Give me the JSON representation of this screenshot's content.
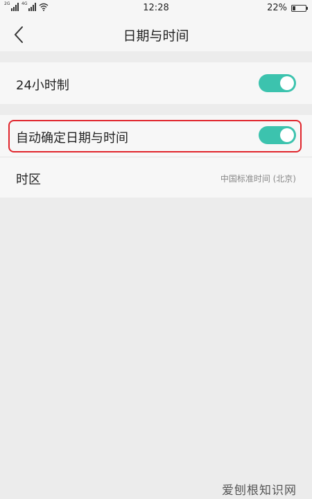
{
  "status_bar": {
    "left_sim1": "2G",
    "left_sim2": "4G",
    "time": "12:28",
    "battery_text": "22%",
    "battery_level": 0.22
  },
  "header": {
    "title": "日期与时间",
    "back_icon": "chevron-left-icon"
  },
  "settings": {
    "hour24": {
      "label": "24小时制",
      "enabled": true
    },
    "auto_datetime": {
      "label": "自动确定日期与时间",
      "enabled": true
    },
    "timezone": {
      "label": "时区",
      "value": "中国标准时间 (北京)"
    }
  },
  "colors": {
    "toggle_on": "#3cc3ae",
    "highlight_border": "#e0242b"
  },
  "watermark": "爱刨根知识网"
}
